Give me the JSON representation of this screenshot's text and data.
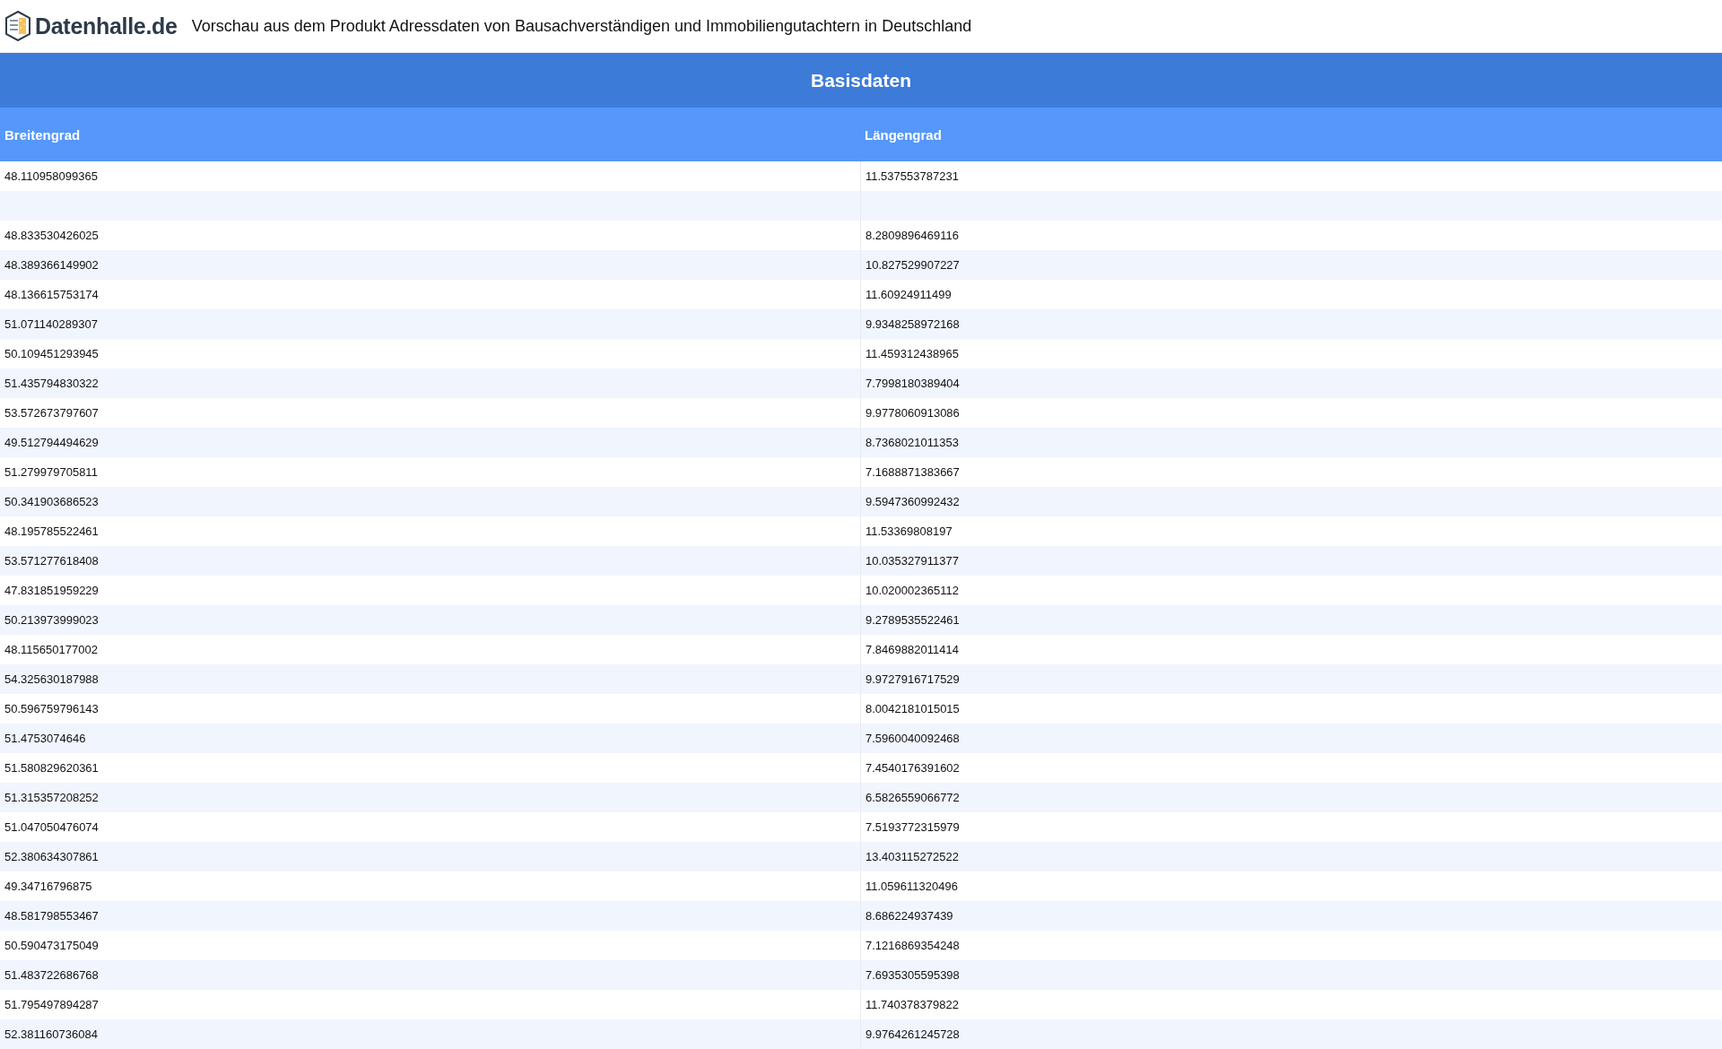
{
  "header": {
    "logo_text": "Datenhalle.de",
    "title": "Vorschau aus dem Produkt Adressdaten von Bausachverständigen und Immobiliengutachtern in Deutschland"
  },
  "table": {
    "group_heading": "Basisdaten",
    "columns": [
      "Breitengrad",
      "Längengrad"
    ],
    "rows": [
      {
        "cells": [
          "48.110958099365",
          "11.537553787231"
        ]
      },
      {
        "cells": []
      },
      {
        "cells": [
          "48.833530426025",
          "8.2809896469116"
        ]
      },
      {
        "cells": [
          "48.389366149902",
          "10.827529907227"
        ]
      },
      {
        "cells": [
          "48.136615753174",
          "11.60924911499"
        ]
      },
      {
        "cells": [
          "51.071140289307",
          "9.9348258972168"
        ]
      },
      {
        "cells": [
          "50.109451293945",
          "11.459312438965"
        ]
      },
      {
        "cells": [
          "51.435794830322",
          "7.7998180389404"
        ]
      },
      {
        "cells": [
          "53.572673797607",
          "9.9778060913086"
        ]
      },
      {
        "cells": [
          "49.512794494629",
          "8.7368021011353"
        ]
      },
      {
        "cells": [
          "51.279979705811",
          "7.1688871383667"
        ]
      },
      {
        "cells": [
          "50.341903686523",
          "9.5947360992432"
        ]
      },
      {
        "cells": [
          "48.195785522461",
          "11.53369808197"
        ]
      },
      {
        "cells": [
          "53.571277618408",
          "10.035327911377"
        ]
      },
      {
        "cells": [
          "47.831851959229",
          "10.020002365112"
        ]
      },
      {
        "cells": [
          "50.213973999023",
          "9.2789535522461"
        ]
      },
      {
        "cells": [
          "48.115650177002",
          "7.8469882011414"
        ]
      },
      {
        "cells": [
          "54.325630187988",
          "9.9727916717529"
        ]
      },
      {
        "cells": [
          "50.596759796143",
          "8.0042181015015"
        ]
      },
      {
        "cells": [
          "51.4753074646",
          "7.5960040092468"
        ]
      },
      {
        "cells": [
          "51.580829620361",
          "7.4540176391602"
        ]
      },
      {
        "cells": [
          "51.315357208252",
          "6.5826559066772"
        ]
      },
      {
        "cells": [
          "51.047050476074",
          "7.5193772315979"
        ]
      },
      {
        "cells": [
          "52.380634307861",
          "13.403115272522"
        ]
      },
      {
        "cells": [
          "49.34716796875",
          "11.059611320496"
        ]
      },
      {
        "cells": [
          "48.581798553467",
          "8.686224937439"
        ]
      },
      {
        "cells": [
          "50.590473175049",
          "7.1216869354248"
        ]
      },
      {
        "cells": [
          "51.483722686768",
          "7.6935305595398"
        ]
      },
      {
        "cells": [
          "51.795497894287",
          "11.740378379822"
        ]
      },
      {
        "cells": [
          "52.381160736084",
          "9.9764261245728"
        ]
      }
    ]
  }
}
